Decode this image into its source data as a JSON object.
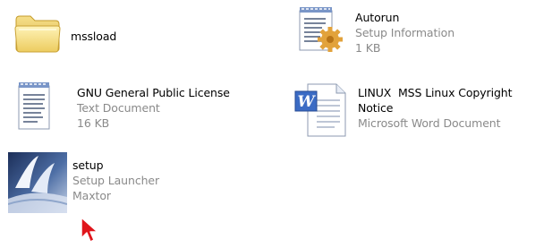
{
  "colors": {
    "background": "#ffffff",
    "primary_text": "#000000",
    "secondary_text": "#8a8a8a"
  },
  "files": {
    "mssload": {
      "name": "mssload",
      "icon": "folder-icon"
    },
    "autorun": {
      "name": "Autorun",
      "type": "Setup Information",
      "size": "1 KB",
      "icon": "setup-information-icon"
    },
    "gpl": {
      "name": "GNU General Public License",
      "type": "Text Document",
      "size": "16 KB",
      "icon": "text-document-icon"
    },
    "notice": {
      "name_line1": "LINUX  MSS Linux Copyright",
      "name_line2": "Notice",
      "type": "Microsoft Word Document",
      "icon": "word-document-icon"
    },
    "setup": {
      "name": "setup",
      "type": "Setup Launcher",
      "company": "Maxtor",
      "icon": "setup-launcher-icon"
    }
  },
  "cursor": {
    "icon": "mouse-pointer-icon"
  }
}
